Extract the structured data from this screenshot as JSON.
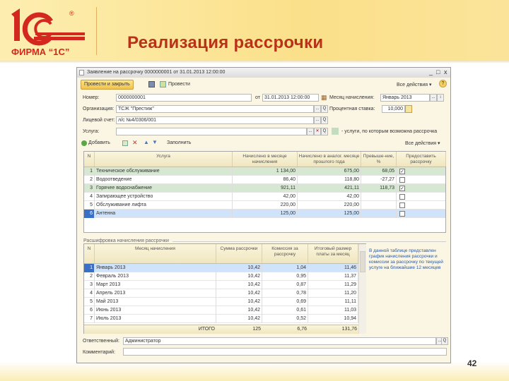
{
  "slide": {
    "title": "Реализация  рассрочки",
    "page_number": "42",
    "logo_text": "ФИРМА “1С”"
  },
  "window": {
    "title": "Заявление на рассрочку 0000000001 от 31.01.2013 12:00:00",
    "min": "_",
    "max": "□",
    "close": "x"
  },
  "toolbar": {
    "post_close": "Провести и закрыть",
    "post": "Провести",
    "all_actions": "Все действия ▾",
    "help": "?"
  },
  "form": {
    "number_label": "Номер:",
    "number_value": "0000000001",
    "date_label": "от",
    "date_value": "31.01.2013 12:00:00",
    "month_label": "Месяц начисления:",
    "month_value": "Январь 2013",
    "org_label": "Организация:",
    "org_value": "ТСЖ \"Престиж\"",
    "rate_label": "Процентная ставка:",
    "rate_value": "10,000",
    "account_label": "Лицевой счет:",
    "account_value": "л/с №4/0306/001",
    "service_label": "Услуга:",
    "service_value": "",
    "legend_text": "- услуги, по которым возможна рассрочка",
    "select_btn": "...",
    "search_btn": "Q",
    "clear_btn": "✕"
  },
  "services_toolbar": {
    "add": "Добавить",
    "fill": "Заполнить",
    "all_actions": "Все действия ▾"
  },
  "services": {
    "headers": [
      "N",
      "Услуга",
      "Начислено в месяце начисления",
      "Начислено в аналог. месяце прошлого года",
      "Превыше-ние, %",
      "Предоставить рассрочку"
    ],
    "rows": [
      {
        "n": "1",
        "name": "Техническое обслуживание",
        "cur": "1 134,00",
        "prev": "675,00",
        "pct": "68,05",
        "checked": true,
        "allowed": true
      },
      {
        "n": "2",
        "name": "Водоотведение",
        "cur": "86,40",
        "prev": "118,80",
        "pct": "-27,27",
        "checked": false,
        "allowed": false
      },
      {
        "n": "3",
        "name": "Горячее водоснабжение",
        "cur": "921,11",
        "prev": "421,11",
        "pct": "118,73",
        "checked": true,
        "allowed": true
      },
      {
        "n": "4",
        "name": "Запирающее устройство",
        "cur": "42,00",
        "prev": "42,00",
        "pct": "",
        "checked": false,
        "allowed": false
      },
      {
        "n": "5",
        "name": "Обслуживание лифта",
        "cur": "220,00",
        "prev": "220,00",
        "pct": "",
        "checked": false,
        "allowed": false
      },
      {
        "n": "6",
        "name": "Антенна",
        "cur": "125,00",
        "prev": "125,00",
        "pct": "",
        "checked": false,
        "allowed": false,
        "selected": true
      }
    ]
  },
  "schedule": {
    "group_title": "Расшифровка начисления рассрочки",
    "headers": [
      "N",
      "Месяц начисления",
      "Сумма рассрочки",
      "Комиссия за рассрочку",
      "Итоговый размер платы за месяц"
    ],
    "rows": [
      {
        "n": "1",
        "month": "Январь 2013",
        "sum": "10,42",
        "fee": "1,04",
        "total": "11,46",
        "selected": true
      },
      {
        "n": "2",
        "month": "Февраль 2013",
        "sum": "10,42",
        "fee": "0,95",
        "total": "11,37"
      },
      {
        "n": "3",
        "month": "Март 2013",
        "sum": "10,42",
        "fee": "0,87",
        "total": "11,29"
      },
      {
        "n": "4",
        "month": "Апрель 2013",
        "sum": "10,42",
        "fee": "0,78",
        "total": "11,20"
      },
      {
        "n": "5",
        "month": "Май 2013",
        "sum": "10,42",
        "fee": "0,69",
        "total": "11,11"
      },
      {
        "n": "6",
        "month": "Июнь 2013",
        "sum": "10,42",
        "fee": "0,61",
        "total": "11,03"
      },
      {
        "n": "7",
        "month": "Июль 2013",
        "sum": "10,42",
        "fee": "0,52",
        "total": "10,94"
      }
    ],
    "totals": {
      "label": "ИТОГО",
      "sum": "125",
      "fee": "6,76",
      "total": "131,76"
    },
    "note": "В данной таблице представлен график начисления рассрочки и комиссии за рассрочку по текущей услуге на ближайшие 12 месяцев"
  },
  "footer": {
    "responsible_label": "Ответственный:",
    "responsible_value": "Администратор",
    "comment_label": "Комментарий:",
    "comment_value": ""
  },
  "colors": {
    "allowed_row": "#d6e8d2",
    "selected_row": "#cfe3fa",
    "accent": "#b8321a"
  }
}
